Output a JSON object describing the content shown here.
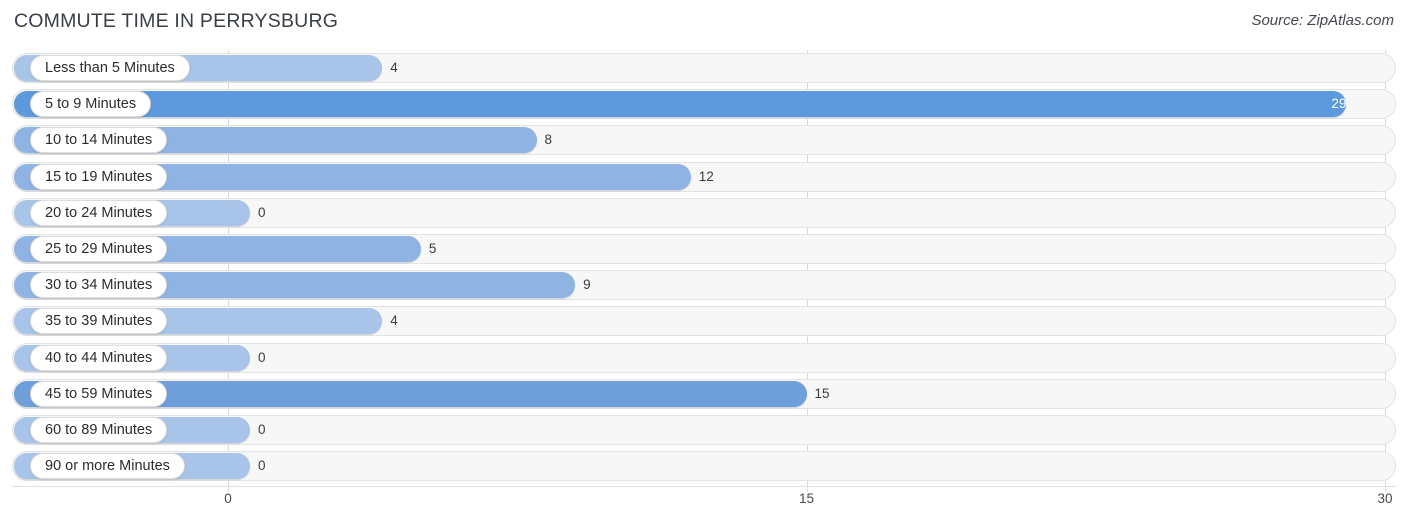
{
  "header": {
    "title": "COMMUTE TIME IN PERRYSBURG",
    "source": "Source: ZipAtlas.com"
  },
  "axis": {
    "ticks": [
      {
        "label": "0",
        "value": 0
      },
      {
        "label": "15",
        "value": 15
      },
      {
        "label": "30",
        "value": 30
      }
    ]
  },
  "colors": {
    "bar_light": "#a8c4e8",
    "bar_mid": "#8fb4e3",
    "bar_strong": "#6f9fda",
    "bar_max": "#5c9add",
    "track": "#f7f7f7",
    "track_border": "#e3e3e3",
    "gridline": "#d8d8d8",
    "title_text": "#3a3f47",
    "value_text": "#3c3c3c",
    "value_text_inside": "#ffffff"
  },
  "chart_data": {
    "type": "bar",
    "orientation": "horizontal",
    "title": "COMMUTE TIME IN PERRYSBURG",
    "subtitle": "",
    "xlabel": "",
    "ylabel": "",
    "xlim": [
      0,
      30
    ],
    "grid": true,
    "legend": "none",
    "xticks": [
      0,
      15,
      30
    ],
    "categories": [
      "Less than 5 Minutes",
      "5 to 9 Minutes",
      "10 to 14 Minutes",
      "15 to 19 Minutes",
      "20 to 24 Minutes",
      "25 to 29 Minutes",
      "30 to 34 Minutes",
      "35 to 39 Minutes",
      "40 to 44 Minutes",
      "45 to 59 Minutes",
      "60 to 89 Minutes",
      "90 or more Minutes"
    ],
    "values": [
      4,
      29,
      8,
      12,
      0,
      5,
      9,
      4,
      0,
      15,
      0,
      0
    ],
    "value_labels": [
      "4",
      "29",
      "8",
      "12",
      "0",
      "5",
      "9",
      "4",
      "0",
      "15",
      "0",
      "0"
    ]
  }
}
